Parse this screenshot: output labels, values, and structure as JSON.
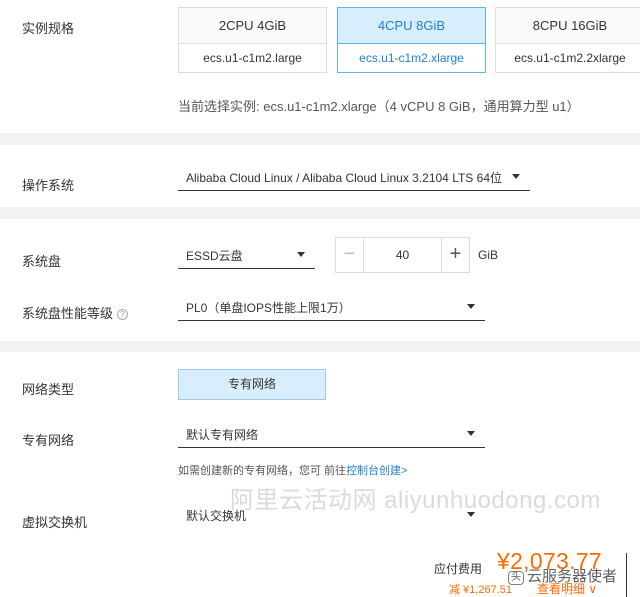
{
  "instance": {
    "label": "实例规格",
    "cards": [
      {
        "spec": "2CPU 4GiB",
        "type": "ecs.u1-c1m2.large",
        "selected": false
      },
      {
        "spec": "4CPU 8GiB",
        "type": "ecs.u1-c1m2.xlarge",
        "selected": true
      },
      {
        "spec": "8CPU 16GiB",
        "type": "ecs.u1-c1m2.2xlarge",
        "selected": false
      }
    ],
    "current": "当前选择实例: ecs.u1-c1m2.xlarge（4 vCPU 8 GiB，通用算力型 u1）"
  },
  "os": {
    "label": "操作系统",
    "value": "Alibaba Cloud Linux / Alibaba Cloud Linux 3.2104 LTS 64位"
  },
  "disk": {
    "label": "系统盘",
    "type": "ESSD云盘",
    "minus": "−",
    "size": "40",
    "plus": "+",
    "unit": "GiB",
    "perf_label": "系统盘性能等级",
    "perf_help": "?",
    "perf_value": "PL0（单盘IOPS性能上限1万）"
  },
  "network": {
    "type_label": "网络类型",
    "type_value": "专有网络",
    "vpc_label": "专有网络",
    "vpc_value": "默认专有网络",
    "hint_prefix": "如需创建新的专有网络，您可 前往",
    "hint_link": "控制台创建>",
    "vswitch_label": "虚拟交换机",
    "vswitch_value": "默认交换机"
  },
  "watermark": "阿里云活动网 aliyunhuodong.com",
  "footer": {
    "pay_label": "应付费用",
    "price": "¥2,073.77",
    "discount": "减 ¥1,267.51",
    "details": "查看明细 ∨",
    "badge_icon": "头",
    "badge_text": "云服务器使者"
  }
}
